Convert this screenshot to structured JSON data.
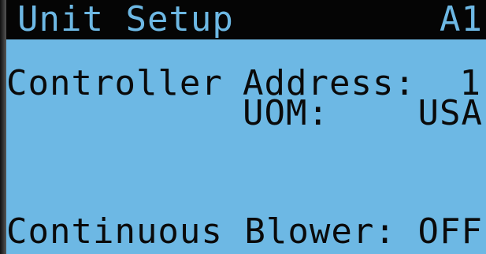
{
  "header": {
    "title": "Unit Setup",
    "screen_id": "A1"
  },
  "controller": {
    "label": "Controller",
    "address_label": "Address:",
    "address_value": "1",
    "uom_label": "UOM:",
    "uom_value": "USA"
  },
  "blower": {
    "label": "Continuous Blower:",
    "value": "OFF"
  },
  "colors": {
    "lcd_background": "#6db8e4",
    "header_background": "#050505",
    "text": "#0a0a0a"
  }
}
